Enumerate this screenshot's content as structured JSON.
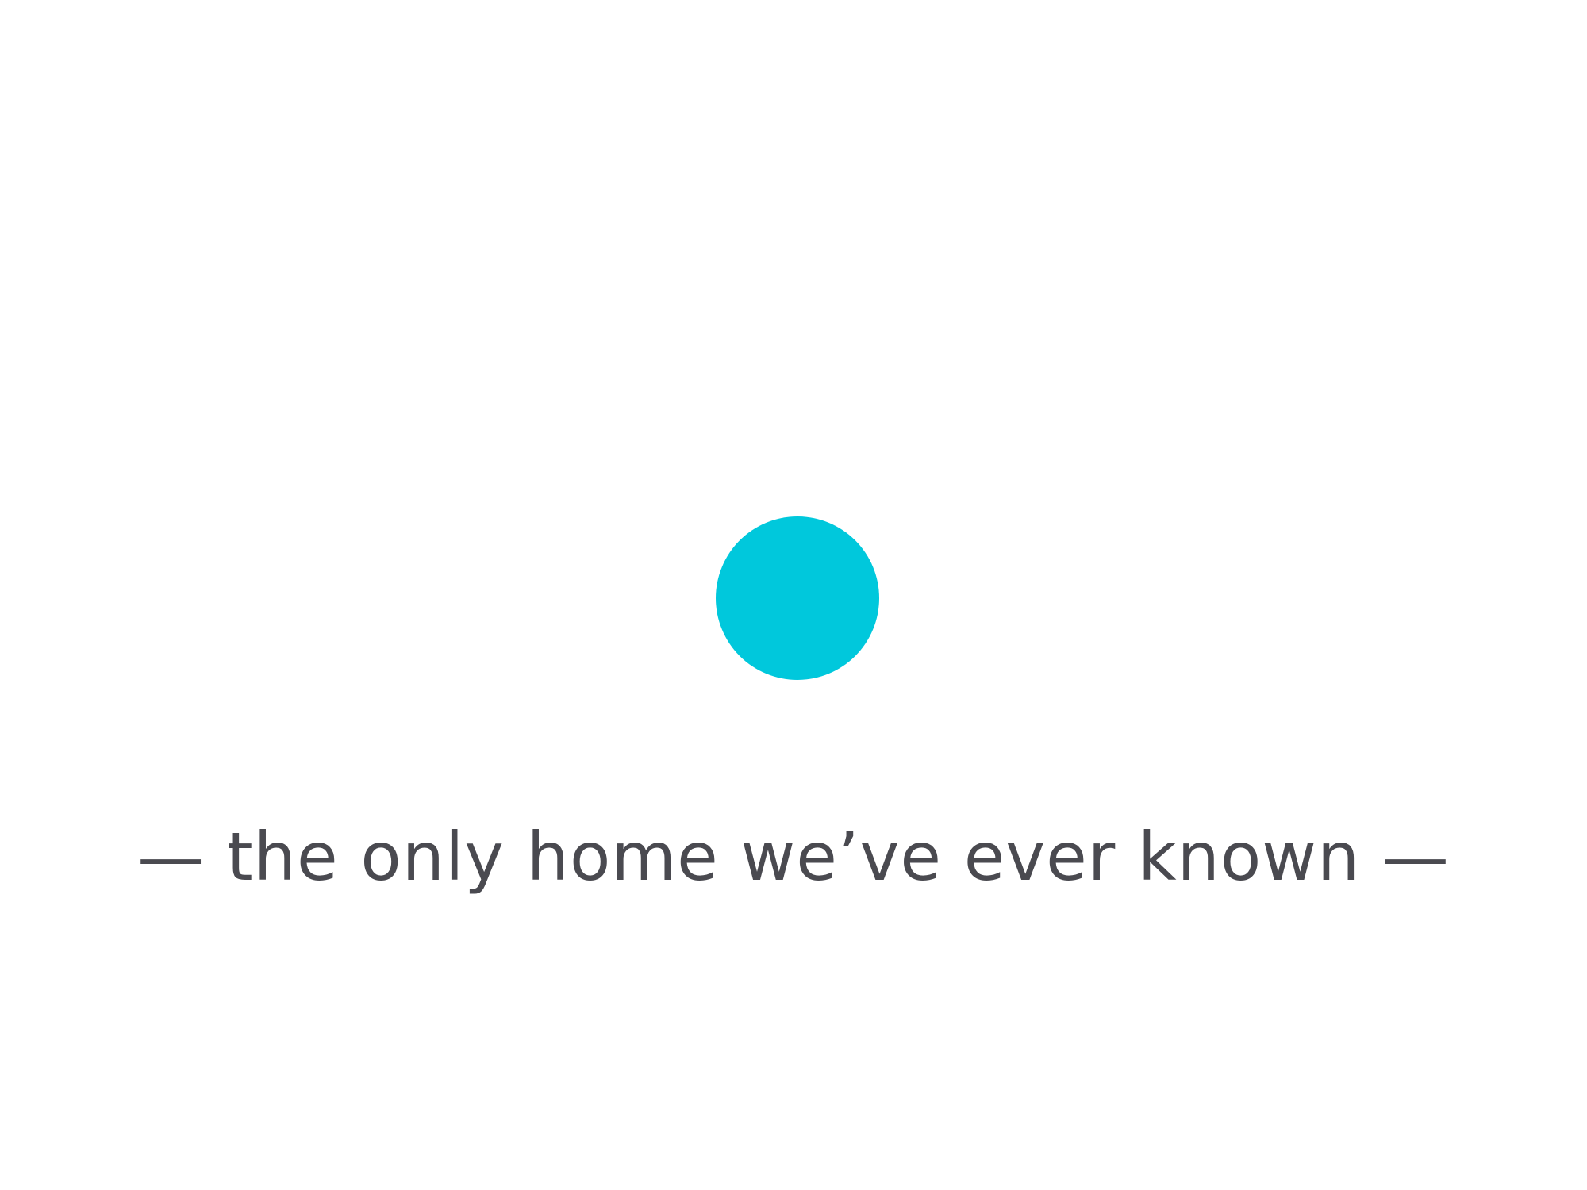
{
  "caption": {
    "text": "— the only home we’ve ever known —"
  },
  "colors": {
    "dot": "#00c8dc",
    "caption": "#4a4a50",
    "background": "#ffffff"
  }
}
